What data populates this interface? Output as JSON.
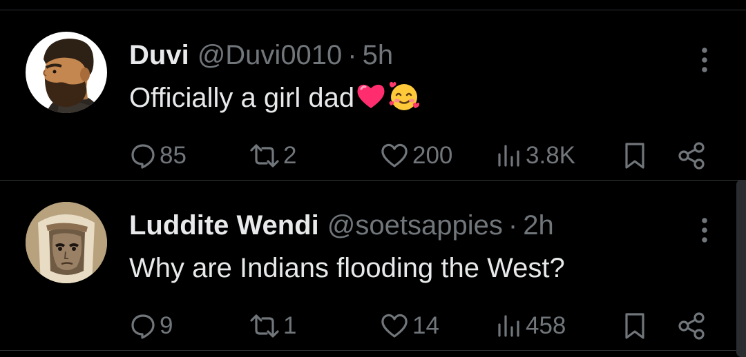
{
  "tweets": [
    {
      "name": "Duvi",
      "handle": "@Duvi0010",
      "separator": "·",
      "time": "5h",
      "text": "Officially a girl dad",
      "emojis": [
        "red-heart",
        "smiling-face-with-hearts"
      ],
      "replies": "85",
      "reposts": "2",
      "likes": "200",
      "views": "3.8K"
    },
    {
      "name": "Luddite Wendi",
      "handle": "@soetsappies",
      "separator": "·",
      "time": "2h",
      "text": "Why are Indians flooding the West?",
      "emojis": [],
      "replies": "9",
      "reposts": "1",
      "likes": "14",
      "views": "458"
    }
  ],
  "colors": {
    "background": "#000000",
    "primary_text": "#e7e9ea",
    "secondary_text": "#71767b",
    "divider": "#2f3336"
  },
  "icons": [
    "reply-icon",
    "repost-icon",
    "like-icon",
    "views-icon",
    "bookmark-icon",
    "share-icon",
    "more-icon"
  ]
}
